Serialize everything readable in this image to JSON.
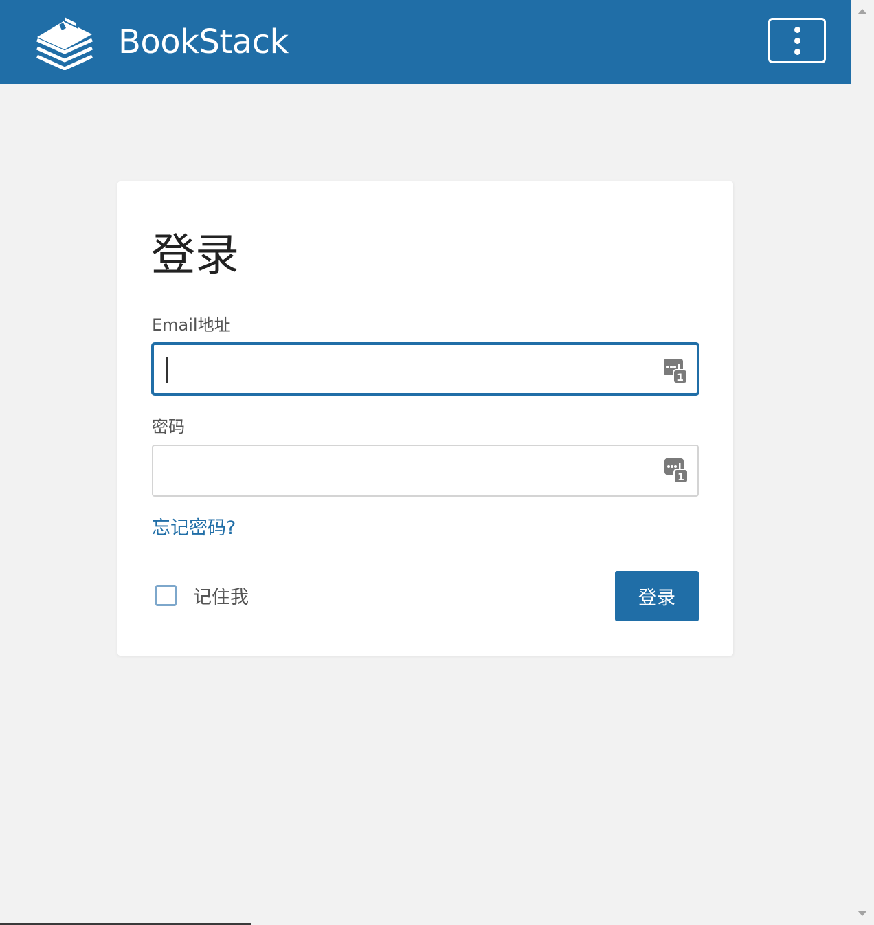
{
  "header": {
    "brand": "BookStack",
    "logo_icon": "bookstack-logo-icon",
    "menu_icon": "more-vertical-icon",
    "color": "#206ea7"
  },
  "login": {
    "title": "登录",
    "email_label": "Email地址",
    "email_value": "",
    "password_label": "密码",
    "password_value": "",
    "forgot_link": "忘记密码?",
    "remember_label": "记住我",
    "remember_checked": false,
    "submit_label": "登录",
    "field_icon": "password-manager-icon"
  }
}
